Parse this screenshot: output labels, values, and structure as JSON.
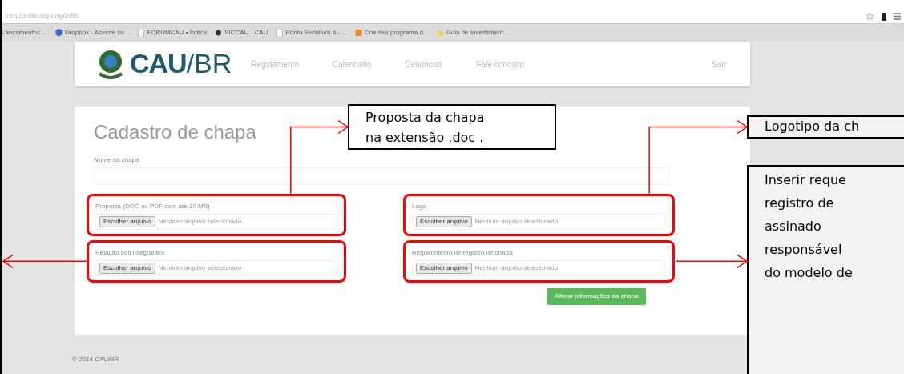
{
  "browser": {
    "url": "toral/political/party/edit/",
    "bookmarks": [
      {
        "label": "Lançamentos ..."
      },
      {
        "label": "Dropbox - Acesse su..."
      },
      {
        "label": "FORUMCAU • Índice"
      },
      {
        "label": "SICCAU - CAU"
      },
      {
        "label": "Ponto Secullum 4 - ..."
      },
      {
        "label": "Crie seu programa d..."
      },
      {
        "label": "Guia de Investiment..."
      }
    ]
  },
  "header": {
    "logo_text": "CAU",
    "logo_suffix": "/BR",
    "nav": [
      "Regulamento",
      "Calendário",
      "Denúncias",
      "Fale conosco"
    ],
    "logout": "Sair"
  },
  "form": {
    "title": "Cadastro de chapa",
    "name_label": "Nome da chapa",
    "file_fields": [
      {
        "label": "Proposta (DOC ou PDF com até 10 MB)",
        "button": "Escolher arquivo",
        "status": "Nenhum arquivo selecionado",
        "highlighted": true
      },
      {
        "label": "Logo",
        "button": "Escolher arquivo",
        "status": "Nenhum arquivo selecionado",
        "highlighted": true
      },
      {
        "label": "Relação dos integrantes",
        "button": "Escolher arquivo",
        "status": "Nenhum arquivo selecionado",
        "highlighted": true
      },
      {
        "label": "Requerimento de registro de chapa",
        "button": "Escolher arquivo",
        "status": "Nenhum arquivo selecionado",
        "highlighted": true
      }
    ],
    "submit": "Alterar informações da chapa"
  },
  "footer": "© 2014 CAU/BR",
  "callouts": [
    {
      "lines": [
        "Proposta da chapa",
        "na extensão .doc ."
      ]
    },
    {
      "lines": [
        "Logotipo da ch"
      ]
    },
    {
      "lines": [
        "Inserir reque",
        "registro de",
        "assinado",
        "responsável",
        "do modelo de"
      ]
    }
  ]
}
